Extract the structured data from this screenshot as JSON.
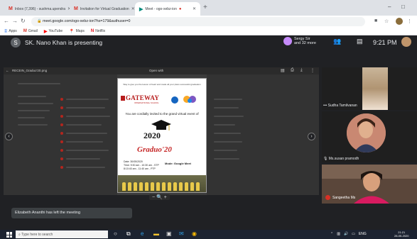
{
  "browser": {
    "tabs": [
      {
        "label": "Inbox (7,396) - sushma.upendra",
        "icon": "gmail"
      },
      {
        "label": "Invitation for Virtual Graduation",
        "icon": "gmail"
      },
      {
        "label": "Meet - ogo-xebz-ion",
        "icon": "meet",
        "active": true
      }
    ],
    "new_tab": "+",
    "url": "meet.google.com/ogo-xebz-ion?hs=179&authuser=0",
    "bookmarks": [
      {
        "label": "Apps",
        "icon": "apps"
      },
      {
        "label": "Gmail",
        "icon": "gmail"
      },
      {
        "label": "YouTube",
        "icon": "youtube"
      },
      {
        "label": "Maps",
        "icon": "maps"
      },
      {
        "label": "Netflix",
        "icon": "netflix"
      }
    ]
  },
  "meet": {
    "presenter_initial": "S",
    "presenting_text": "SK. Nano Khan is presenting",
    "people_text_line1": "Sergy Sir",
    "people_text_line2": "and 32 more",
    "people_count": "33",
    "time": "9:21 PM",
    "participants": [
      {
        "name": "Sudha Tamilvanan"
      },
      {
        "name": "Ms.susan pramodh"
      },
      {
        "name": "Sangeetha Ms",
        "initial": "S"
      }
    ],
    "toast": "Elizabeth Ananthi has left the meeting"
  },
  "shared_screen": {
    "file_name": "RECEIN_Graduo'20.png",
    "open_with": "Open with",
    "zoom_controls": "− 🔍 +"
  },
  "invite": {
    "top_text": "Way to give you the lesson of heart and made all your plans successful graduation",
    "logo": "GATEWAY",
    "logo_sub": "INTERNATIONAL SCHOOL",
    "invited_text": "You are cordially invited to the grand virtual event of",
    "year": "2020",
    "title": "Graduo'20",
    "date_line1": "Date: 30/05/2020",
    "date_line2": "Time: 9:30 am - 10:30 am - STP",
    "date_line3": "8:10:40 am - 11:40 am - PTP",
    "mode": "Mode: Google Meet"
  },
  "taskbar": {
    "search_placeholder": "Type here to search",
    "tray_lang": "ENG",
    "tray_time": "21:21",
    "tray_date": "28-05-2020"
  },
  "colors": {
    "meet_bg": "#202124",
    "gateway_red": "#b71c1c",
    "title_red": "#c62828",
    "taskbar": "#1c2331"
  }
}
